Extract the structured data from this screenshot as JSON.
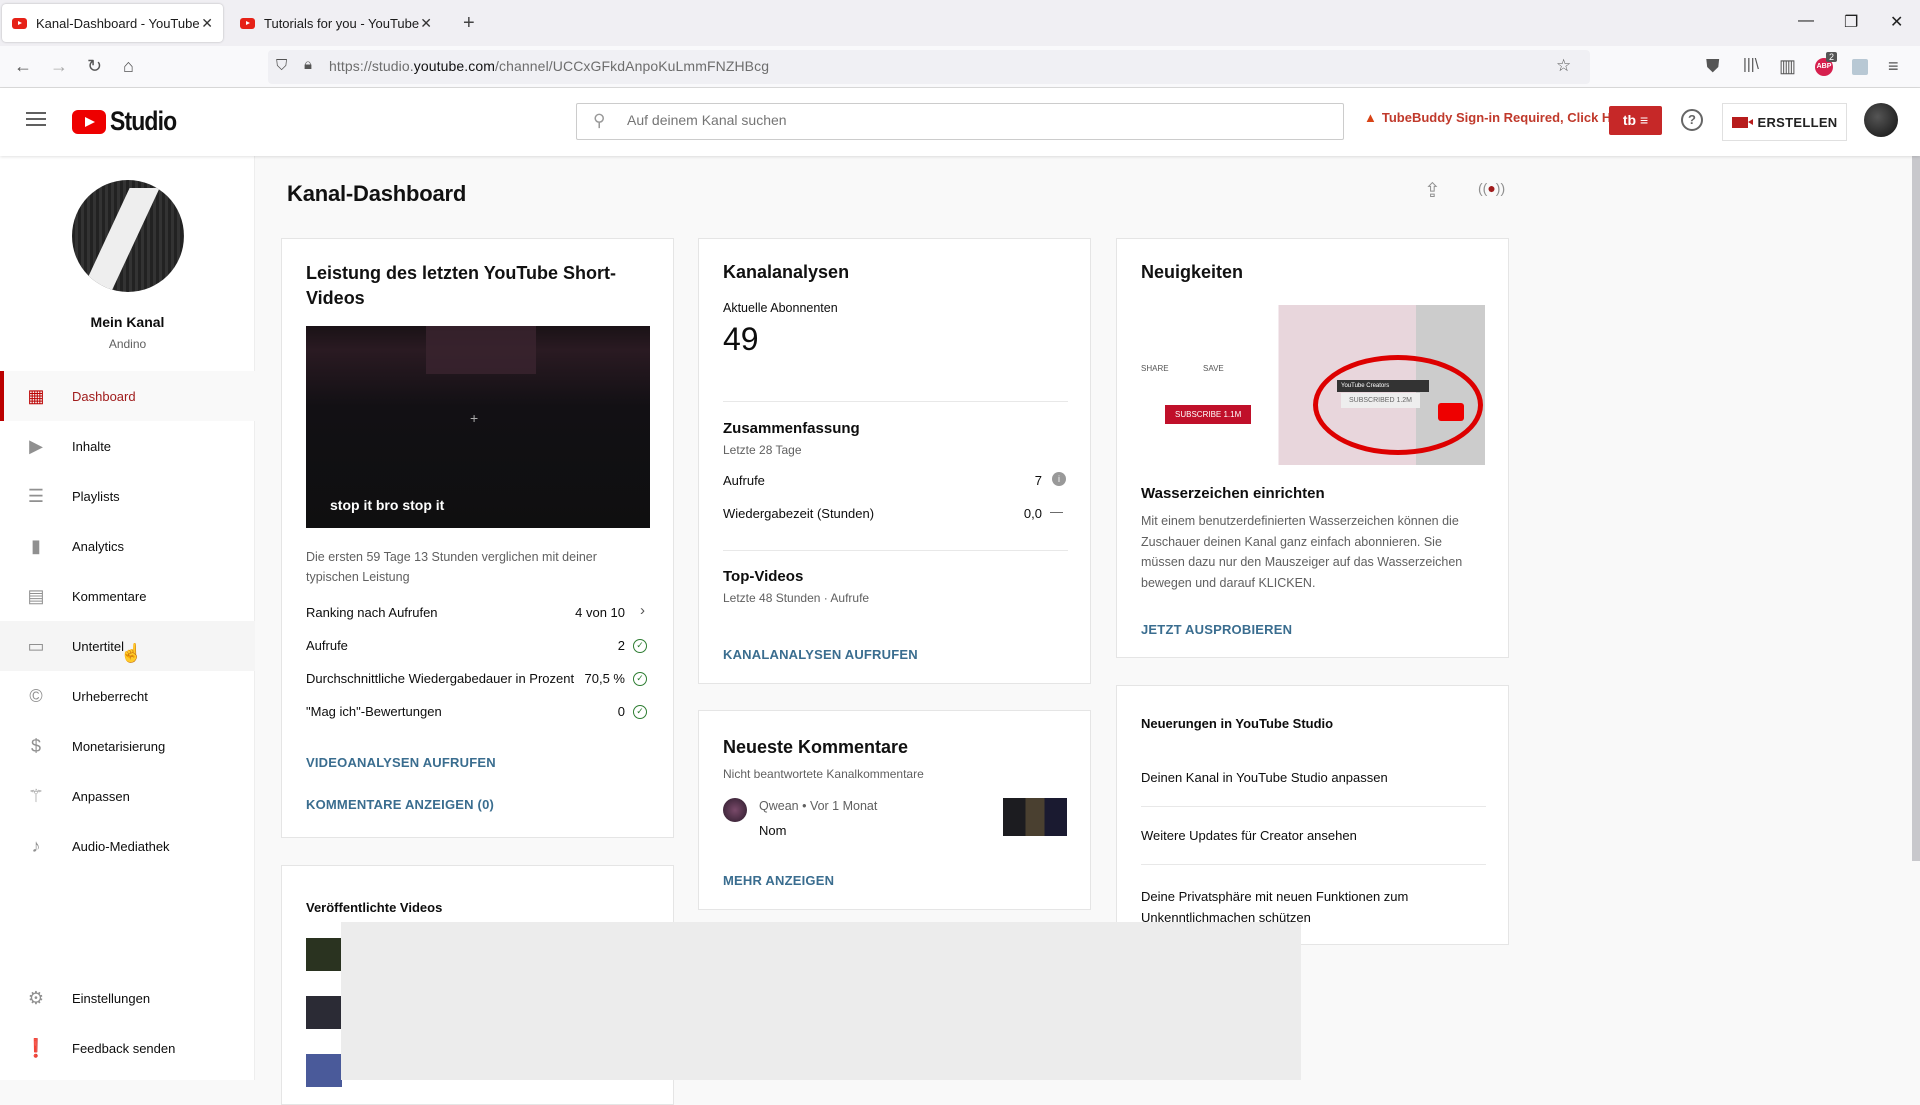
{
  "browser": {
    "tabs": [
      {
        "title": "Kanal-Dashboard - YouTube Stu",
        "active": true
      },
      {
        "title": "Tutorials for you - YouTube",
        "active": false
      }
    ],
    "url_prefix": "https://studio.",
    "url_domain": "youtube.com",
    "url_path": "/channel/UCCxGFkdAnpoKuLmmFNZHBcg",
    "abp_badge": "2"
  },
  "header": {
    "logo_text": "Studio",
    "search_placeholder": "Auf deinem Kanal suchen",
    "tubebuddy_notice": "TubeBuddy Sign-in Required, Click Here",
    "tubebuddy_btn": "tb ≡",
    "create_label": "ERSTELLEN"
  },
  "sidebar": {
    "channel_name": "Mein Kanal",
    "channel_handle": "Andino",
    "items": [
      {
        "label": "Dashboard",
        "icon": "dashboard-icon",
        "active": true
      },
      {
        "label": "Inhalte",
        "icon": "content-icon"
      },
      {
        "label": "Playlists",
        "icon": "playlist-icon"
      },
      {
        "label": "Analytics",
        "icon": "analytics-icon"
      },
      {
        "label": "Kommentare",
        "icon": "comments-icon"
      },
      {
        "label": "Untertitel",
        "icon": "subtitles-icon",
        "hover": true
      },
      {
        "label": "Urheberrecht",
        "icon": "copyright-icon"
      },
      {
        "label": "Monetarisierung",
        "icon": "dollar-icon"
      },
      {
        "label": "Anpassen",
        "icon": "magic-wand-icon"
      },
      {
        "label": "Audio-Mediathek",
        "icon": "audio-library-icon"
      }
    ],
    "bottom_items": [
      {
        "label": "Einstellungen",
        "icon": "gear-icon"
      },
      {
        "label": "Feedback senden",
        "icon": "feedback-icon"
      }
    ]
  },
  "page": {
    "title": "Kanal-Dashboard"
  },
  "short_card": {
    "title": "Leistung des letzten YouTube Short-Videos",
    "thumb_title": "stop it bro stop it",
    "note": "Die ersten 59 Tage 13 Stunden verglichen mit deiner typischen Leistung",
    "rows": [
      {
        "label": "Ranking nach Aufrufen",
        "value": "4 von 10",
        "indicator": "chevron"
      },
      {
        "label": "Aufrufe",
        "value": "2",
        "indicator": "check"
      },
      {
        "label": "Durchschnittliche Wiedergabedauer in Prozent",
        "value": "70,5 %",
        "indicator": "check"
      },
      {
        "label": "\"Mag ich\"-Bewertungen",
        "value": "0",
        "indicator": "check"
      }
    ],
    "link1": "VIDEOANALYSEN AUFRUFEN",
    "link2": "KOMMENTARE ANZEIGEN (0)"
  },
  "published_card": {
    "title": "Veröffentlichte Videos"
  },
  "analytics_card": {
    "title": "Kanalanalysen",
    "subs_label": "Aktuelle Abonnenten",
    "subs_value": "49",
    "summary_title": "Zusammenfassung",
    "summary_period": "Letzte 28 Tage",
    "rows": [
      {
        "label": "Aufrufe",
        "value": "7",
        "indicator": "info"
      },
      {
        "label": "Wiedergabezeit (Stunden)",
        "value": "0,0",
        "indicator": "dash"
      }
    ],
    "top_title": "Top-Videos",
    "top_period": "Letzte 48 Stunden · Aufrufe",
    "link": "KANALANALYSEN AUFRUFEN"
  },
  "comments_card": {
    "title": "Neueste Kommentare",
    "subtitle": "Nicht beantwortete Kanalkommentare",
    "comment": {
      "author": "Qwean",
      "time": "Vor 1 Monat",
      "text": "Nom"
    },
    "link": "MEHR ANZEIGEN"
  },
  "news_card": {
    "title": "Neuigkeiten",
    "image_labels": {
      "share": "SHARE",
      "save": "SAVE",
      "subscribe": "SUBSCRIBE  1.1M",
      "creators": "YouTube Creators",
      "subscribed": "SUBSCRIBED 1.2M"
    },
    "headline": "Wasserzeichen einrichten",
    "body": "Mit einem benutzerdefinierten Wasserzeichen können die Zuschauer deinen Kanal ganz einfach abonnieren. Sie müssen dazu nur den Mauszeiger auf das Wasserzeichen bewegen und darauf KLICKEN.",
    "link": "JETZT AUSPROBIEREN"
  },
  "updates_card": {
    "title": "Neuerungen in YouTube Studio",
    "items": [
      "Deinen Kanal in YouTube Studio anpassen",
      "Weitere Updates für Creator ansehen",
      "Deine Privatsphäre mit neuen Funktionen zum Unkenntlichmachen schützen"
    ]
  }
}
